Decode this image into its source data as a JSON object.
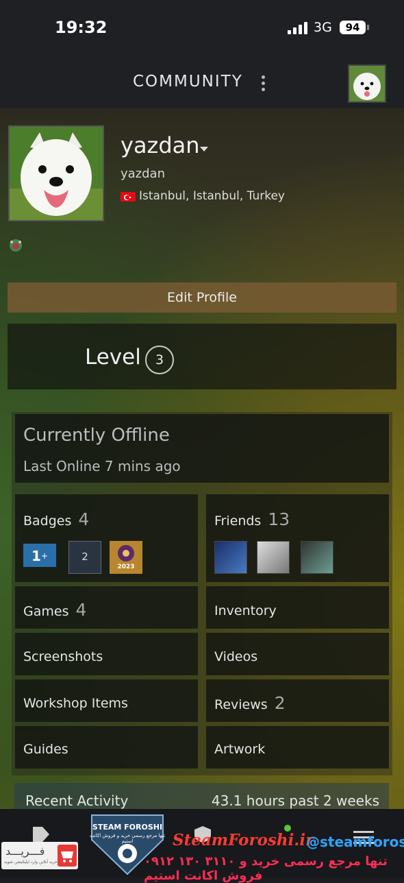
{
  "status": {
    "time": "19:32",
    "network": "3G",
    "battery": "94"
  },
  "header": {
    "title": "COMMUNITY"
  },
  "profile": {
    "name": "yazdan",
    "real_name": "yazdan",
    "location": "Istanbul, Istanbul, Turkey",
    "edit_label": "Edit Profile",
    "level_label": "Level",
    "level_value": "3"
  },
  "status_box": {
    "title": "Currently Offline",
    "last_online": "Last Online 7 mins ago"
  },
  "grid": {
    "badges_label": "Badges",
    "badges_count": "4",
    "badge_item_2": "2",
    "badge_item_year": "2023",
    "friends_label": "Friends",
    "friends_count": "13",
    "games_label": "Games",
    "games_count": "4",
    "inventory_label": "Inventory",
    "screenshots_label": "Screenshots",
    "videos_label": "Videos",
    "workshop_label": "Workshop Items",
    "reviews_label": "Reviews",
    "reviews_count": "2",
    "guides_label": "Guides",
    "artwork_label": "Artwork"
  },
  "recent": {
    "label": "Recent Activity",
    "hours": "43.1 hours past 2 weeks"
  },
  "watermark": {
    "brand": "SteamForoshi.ir",
    "handle": "@steamforoshi",
    "phone": "۰۹۱۲ ۱۳۰ ۳۱۱۰ تنها مرجع رسمی خرید و فروش اکانت استیم",
    "logo_title": "STEAM FOROSHI",
    "logo_sub": "تنها مرجع رسمی خرید و فروش اکانت استیم",
    "left_title": "فـــریـــد",
    "left_sub": "برای خرید آنلاین وارد اپلیکیشن شوید"
  },
  "colors": {
    "accent_red": "#ff3b30",
    "accent_blue": "#2fa3ff"
  }
}
